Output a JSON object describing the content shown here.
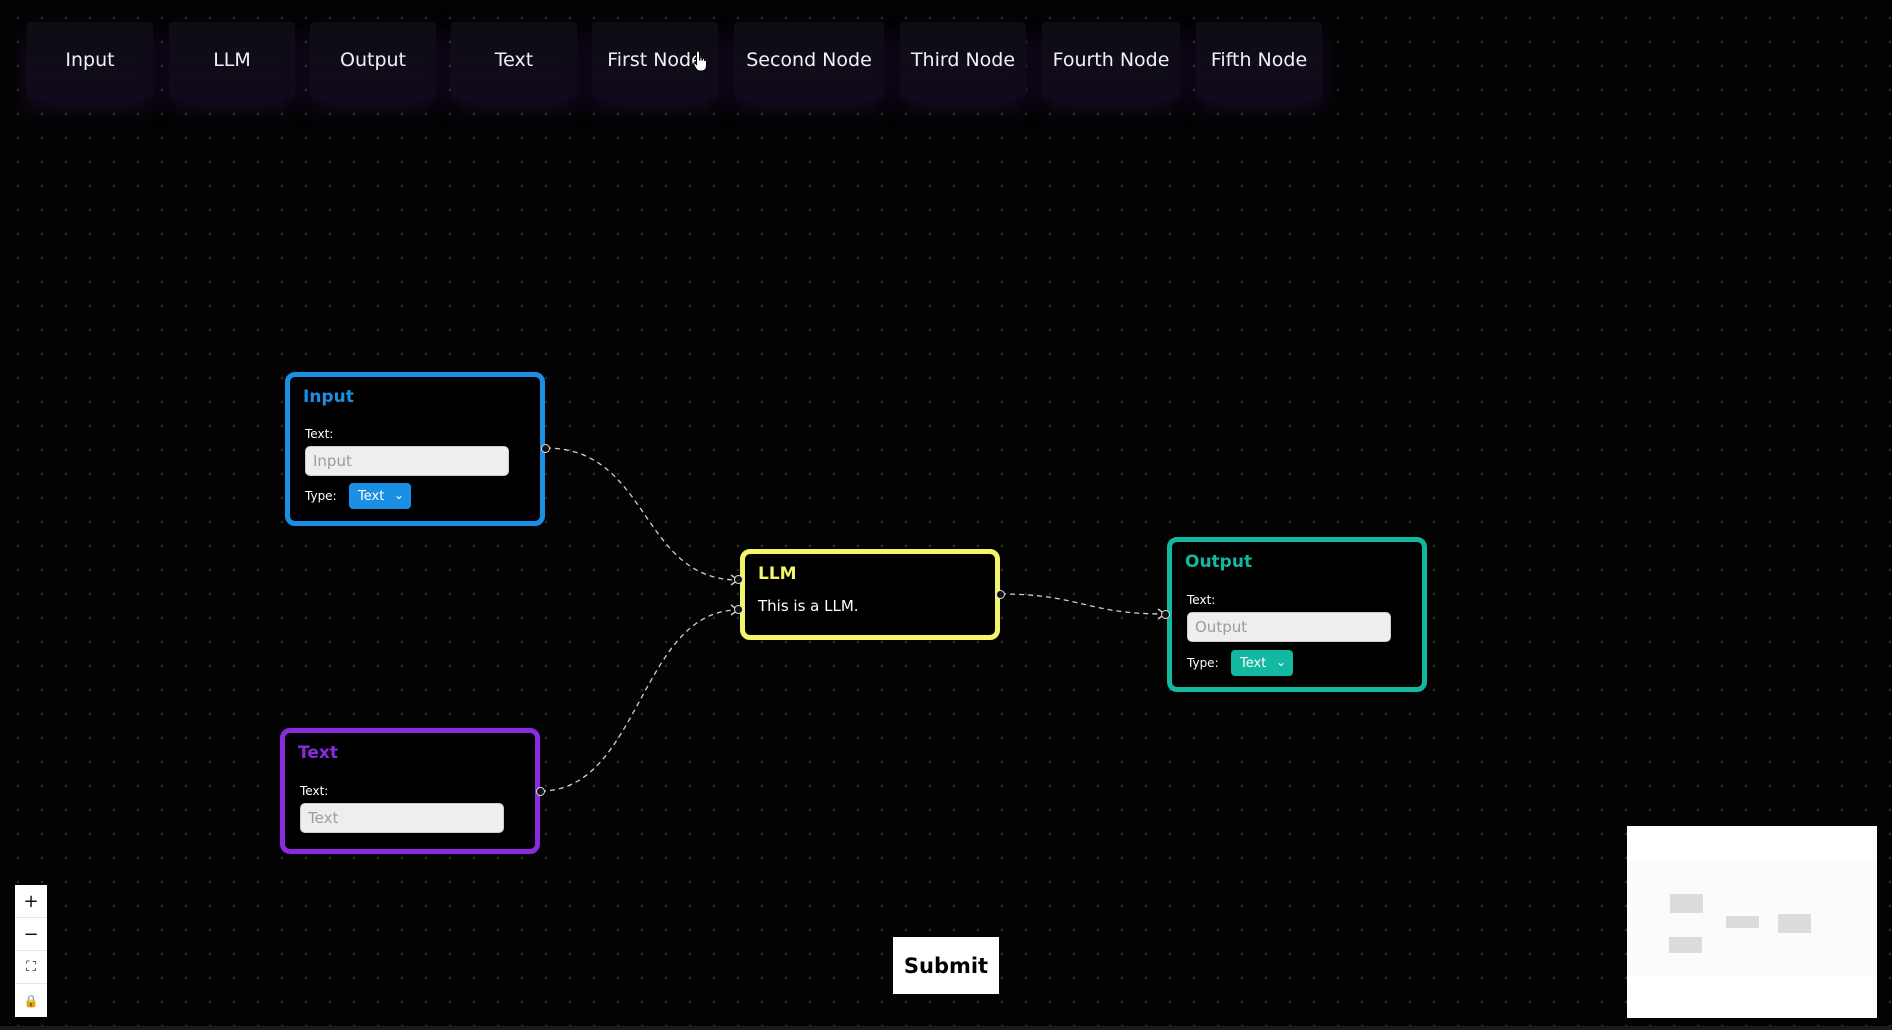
{
  "toolbar": {
    "items": [
      {
        "label": "Input"
      },
      {
        "label": "LLM"
      },
      {
        "label": "Output"
      },
      {
        "label": "Text"
      },
      {
        "label": "First Node"
      },
      {
        "label": "Second Node"
      },
      {
        "label": "Third Node"
      },
      {
        "label": "Fourth Node"
      },
      {
        "label": "Fifth Node"
      }
    ]
  },
  "nodes": {
    "input": {
      "title": "Input",
      "text_label": "Text:",
      "placeholder": "Input",
      "type_label": "Type:",
      "type_value": "Text",
      "color": "#1a8fe3"
    },
    "llm": {
      "title": "LLM",
      "description": "This is a LLM.",
      "color": "#f5f56b"
    },
    "output": {
      "title": "Output",
      "text_label": "Text:",
      "placeholder": "Output",
      "type_label": "Type:",
      "type_value": "Text",
      "color": "#12b8a0"
    },
    "text": {
      "title": "Text",
      "text_label": "Text:",
      "placeholder": "Text",
      "color": "#8a2be2"
    }
  },
  "controls": {
    "zoom_in": "+",
    "zoom_out": "−",
    "fit_view": "⛶",
    "lock": "🔒"
  },
  "submit": {
    "label": "Submit"
  }
}
